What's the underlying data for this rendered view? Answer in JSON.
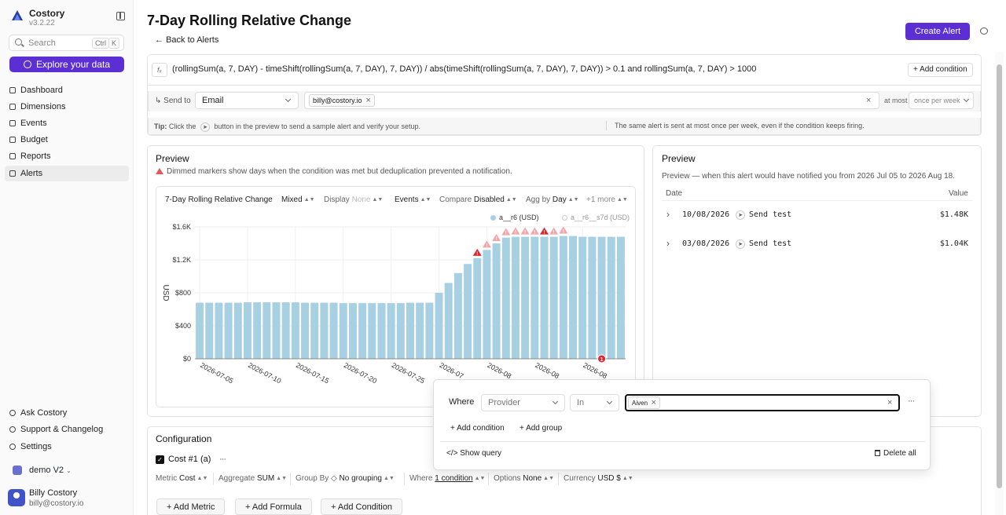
{
  "app": {
    "name": "Costory",
    "version": "v3.2.22"
  },
  "sidebar": {
    "search_placeholder": "Search",
    "search_kbd": [
      "Ctrl",
      "K"
    ],
    "explore_label": "Explore your data",
    "items": [
      {
        "label": "Dashboard",
        "active": false
      },
      {
        "label": "Dimensions",
        "active": false
      },
      {
        "label": "Events",
        "active": false
      },
      {
        "label": "Budget",
        "active": false
      },
      {
        "label": "Reports",
        "active": false
      },
      {
        "label": "Alerts",
        "active": true
      }
    ],
    "bottom_items": [
      {
        "label": "Ask Costory"
      },
      {
        "label": "Support & Changelog"
      },
      {
        "label": "Settings"
      }
    ],
    "workspace": "demo V2",
    "user": {
      "name": "Billy Costory",
      "email": "billy@costory.io"
    }
  },
  "header": {
    "title": "7-Day Rolling Relative Change",
    "more": "···",
    "back": "Back to Alerts",
    "create_alert": "Create Alert"
  },
  "condition": {
    "formula": "(rollingSum(a, 7, DAY) - timeShift(rollingSum(a, 7, DAY), 7, DAY)) / abs(timeShift(rollingSum(a, 7, DAY), 7, DAY)) > 0.1 and rollingSum(a, 7, DAY) > 1000",
    "add_condition": "+ Add condition"
  },
  "send": {
    "label": "Send to",
    "channel": "Email",
    "recipient": "billy@costory.io",
    "at_most_label": "at most",
    "frequency": "once per week"
  },
  "tips": {
    "tip_label": "Tip:",
    "tip_pre": "Click the",
    "tip_post": "button in the preview to send a sample alert and verify your setup.",
    "note": "The same alert is sent at most once per week, even if the condition keeps firing."
  },
  "preview_left": {
    "title": "Preview",
    "warning": "Dimmed markers show days when the condition was met but deduplication prevented a notification.",
    "toolbar": {
      "chart_name": "7-Day Rolling Relative Change",
      "mode": "Mixed",
      "display_label": "Display",
      "display_value": "None",
      "events": "Events",
      "compare_label": "Compare",
      "compare_value": "Disabled",
      "agg_label": "Agg by",
      "agg_value": "Day",
      "more": "+1 more"
    }
  },
  "preview_right": {
    "title": "Preview",
    "subtitle": "Preview — when this alert would have notified you from 2026 Jul 05 to 2026 Aug 18.",
    "col_date": "Date",
    "col_value": "Value",
    "rows": [
      {
        "date": "10/08/2026",
        "action": "Send test",
        "value": "$1.48K"
      },
      {
        "date": "03/08/2026",
        "action": "Send test",
        "value": "$1.04K"
      }
    ]
  },
  "where_popover": {
    "where_label": "Where",
    "field": "Provider",
    "operator": "In",
    "value_chip": "Aiven",
    "add_condition": "+ Add condition",
    "add_group": "+ Add group",
    "show_query": "</> Show query",
    "delete_all": "Delete all"
  },
  "configuration": {
    "title": "Configuration",
    "metric_name": "Cost #1 (a)",
    "items": [
      {
        "label": "Metric",
        "value": "Cost"
      },
      {
        "label": "Aggregate",
        "value": "SUM"
      },
      {
        "label": "Group By",
        "value": "No grouping"
      },
      {
        "label": "Where",
        "value": "1 condition"
      },
      {
        "label": "Options",
        "value": "None"
      },
      {
        "label": "Currency",
        "value": "USD $"
      }
    ],
    "buttons": [
      "+ Add Metric",
      "+ Add Formula",
      "+ Add Condition"
    ]
  },
  "colors": {
    "accent": "#5b2fd4",
    "bar": "#a8d0e3",
    "alert": "#e0232d",
    "alert_dim": "#f3a6a9"
  },
  "chart_data": {
    "type": "bar",
    "title": "",
    "ylabel": "USD",
    "ylim": [
      0,
      1600
    ],
    "yticks": [
      "$0",
      "$400",
      "$800",
      "$1.2K",
      "$1.6K"
    ],
    "legend": [
      "a__r6 (USD)",
      "a__r6__s7d (USD)"
    ],
    "xtick_labels": [
      "2026-07-05",
      "2026-07-10",
      "2026-07-15",
      "2026-07-20",
      "2026-07-25",
      "2026-07",
      "2026-08",
      "2026-08",
      "2026-08"
    ],
    "categories": [
      "2026-07-05",
      "2026-07-06",
      "2026-07-07",
      "2026-07-08",
      "2026-07-09",
      "2026-07-10",
      "2026-07-11",
      "2026-07-12",
      "2026-07-13",
      "2026-07-14",
      "2026-07-15",
      "2026-07-16",
      "2026-07-17",
      "2026-07-18",
      "2026-07-19",
      "2026-07-20",
      "2026-07-21",
      "2026-07-22",
      "2026-07-23",
      "2026-07-24",
      "2026-07-25",
      "2026-07-26",
      "2026-07-27",
      "2026-07-28",
      "2026-07-29",
      "2026-07-30",
      "2026-07-31",
      "2026-08-01",
      "2026-08-02",
      "2026-08-03",
      "2026-08-04",
      "2026-08-05",
      "2026-08-06",
      "2026-08-07",
      "2026-08-08",
      "2026-08-09",
      "2026-08-10",
      "2026-08-11",
      "2026-08-12",
      "2026-08-13",
      "2026-08-14",
      "2026-08-15",
      "2026-08-16",
      "2026-08-17",
      "2026-08-18"
    ],
    "series": [
      {
        "name": "a__r6 (USD)",
        "values": [
          680,
          680,
          680,
          680,
          680,
          685,
          685,
          685,
          685,
          685,
          685,
          680,
          680,
          680,
          680,
          675,
          675,
          675,
          675,
          675,
          675,
          675,
          680,
          680,
          680,
          800,
          920,
          1040,
          1150,
          1220,
          1320,
          1400,
          1470,
          1480,
          1480,
          1480,
          1480,
          1480,
          1490,
          1490,
          1480,
          1480,
          1480,
          1480,
          1480
        ]
      }
    ],
    "markers": [
      {
        "date": "2026-08-03",
        "kind": "sent"
      },
      {
        "date": "2026-08-04",
        "kind": "dimmed"
      },
      {
        "date": "2026-08-05",
        "kind": "dimmed"
      },
      {
        "date": "2026-08-06",
        "kind": "dimmed"
      },
      {
        "date": "2026-08-07",
        "kind": "dimmed"
      },
      {
        "date": "2026-08-08",
        "kind": "dimmed"
      },
      {
        "date": "2026-08-09",
        "kind": "dimmed"
      },
      {
        "date": "2026-08-10",
        "kind": "sent"
      },
      {
        "date": "2026-08-11",
        "kind": "dimmed"
      },
      {
        "date": "2026-08-12",
        "kind": "dimmed"
      }
    ],
    "event_badge": {
      "date": "2026-08-16",
      "label": "1"
    },
    "grid": true
  }
}
